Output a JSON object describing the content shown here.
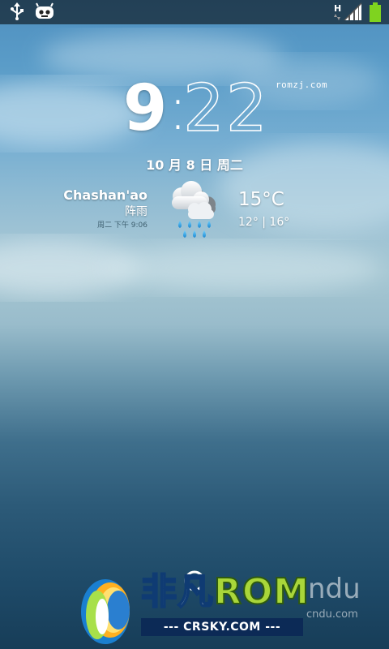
{
  "clock": {
    "hour": "9",
    "separator": ":",
    "minutes": "22",
    "watermark": "romzj.com"
  },
  "date": "10 月 8 日 周二",
  "weather": {
    "location": "Chashan'ao",
    "condition": "阵雨",
    "updated": "周二 下午 9:06",
    "temperature": "15°C",
    "range": "12° | 16°",
    "icon": "cloud-rain-icon"
  },
  "status_bar": {
    "left_icons": [
      "usb-icon",
      "cyanogenmod-icon"
    ],
    "network_type": "H",
    "right_icons": [
      "signal-icon",
      "battery-icon"
    ],
    "battery_color": "#7fd31f"
  },
  "watermarks": {
    "logo_cn": "非凡",
    "logo_rom": "ROM",
    "logo_sub": "--- CRSKY.COM ---",
    "baidu": "ndu",
    "baidu_sub": "cndu.com"
  }
}
